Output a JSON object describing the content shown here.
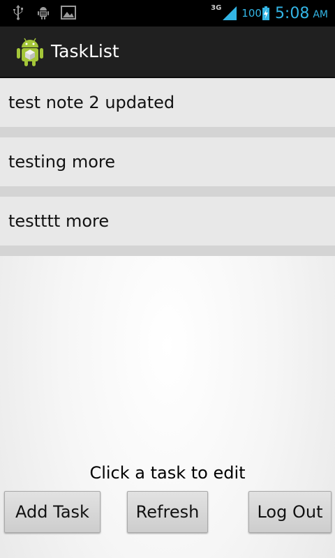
{
  "status_bar": {
    "network_type": "3G",
    "battery_level": "100",
    "clock_time": "5:08",
    "clock_ampm": "AM",
    "icons": [
      "usb-icon",
      "android-debug-icon",
      "image-icon",
      "signal-icon",
      "battery-charging-icon"
    ]
  },
  "action_bar": {
    "title": "TaskList",
    "icon": "android-app-icon"
  },
  "tasks": [
    {
      "label": "test note 2 updated"
    },
    {
      "label": "testing more"
    },
    {
      "label": "testttt more"
    }
  ],
  "hint": "Click a task to edit",
  "buttons": {
    "add": "Add Task",
    "refresh": "Refresh",
    "logout": "Log Out"
  },
  "colors": {
    "accent": "#33b5e5",
    "action_bar_bg": "#202020"
  }
}
